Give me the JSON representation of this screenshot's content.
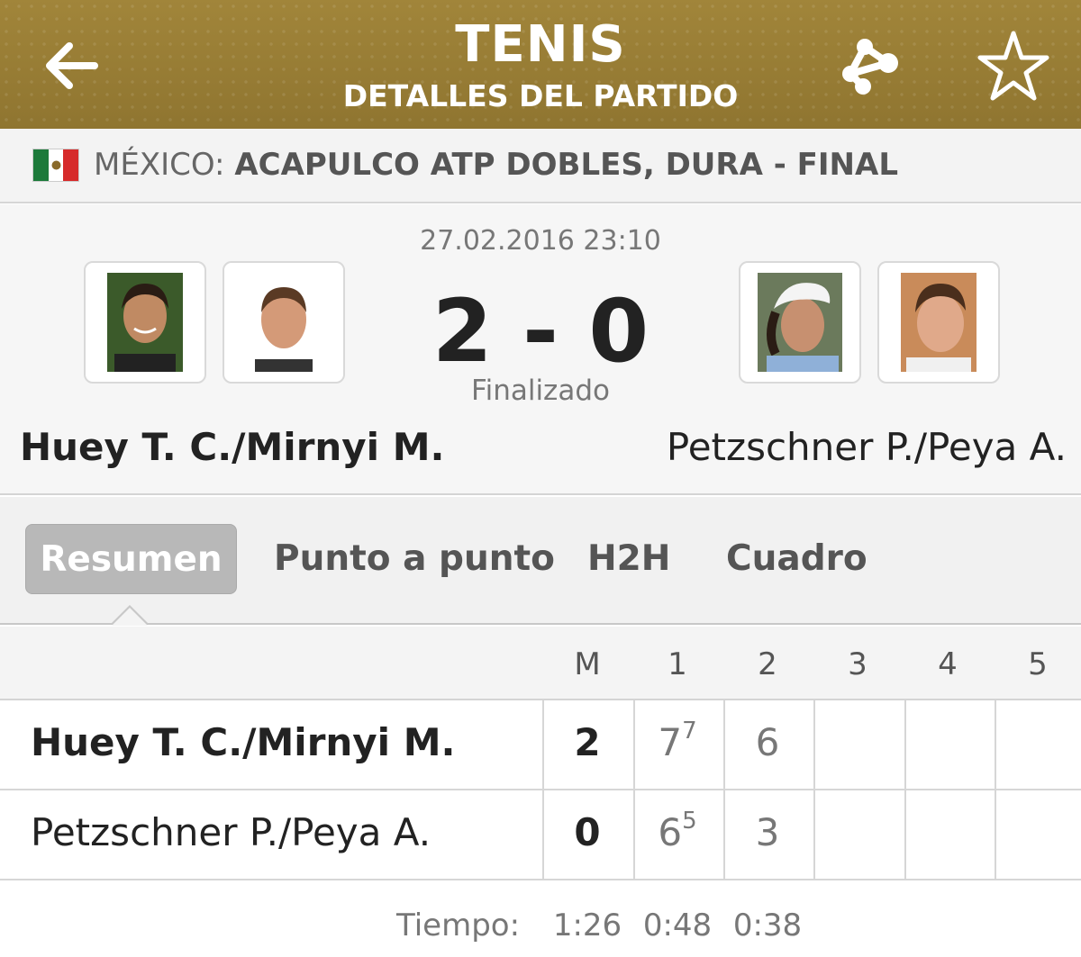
{
  "header": {
    "title": "TENIS",
    "subtitle": "DETALLES DEL PARTIDO",
    "icons": [
      "back-arrow-icon",
      "share-icon",
      "star-icon"
    ],
    "accent_color": "#9a7f36"
  },
  "league": {
    "flag": "mexico-flag",
    "country": "MÉXICO:",
    "name": "ACAPULCO ATP DOBLES, DURA - FINAL"
  },
  "match": {
    "datetime": "27.02.2016 23:10",
    "score": "2 - 0",
    "status": "Finalizado",
    "home_team": "Huey T. C./Mirnyi M.",
    "away_team": "Petzschner P./Peya A."
  },
  "tabs": [
    {
      "label": "Resumen",
      "active": true
    },
    {
      "label": "Punto a punto",
      "active": false
    },
    {
      "label": "H2H",
      "active": false
    },
    {
      "label": "Cuadro",
      "active": false
    }
  ],
  "scoreboard": {
    "columns": [
      "M",
      "1",
      "2",
      "3",
      "4",
      "5"
    ],
    "rows": [
      {
        "name": "Huey T. C./Mirnyi M.",
        "sets": "2",
        "set1": "7",
        "set1_tb": "7",
        "set2": "6"
      },
      {
        "name": "Petzschner P./Peya A.",
        "sets": "0",
        "set1": "6",
        "set1_tb": "5",
        "set2": "3"
      }
    ],
    "time_label": "Tiempo:",
    "times": [
      "1:26",
      "0:48",
      "0:38"
    ]
  }
}
